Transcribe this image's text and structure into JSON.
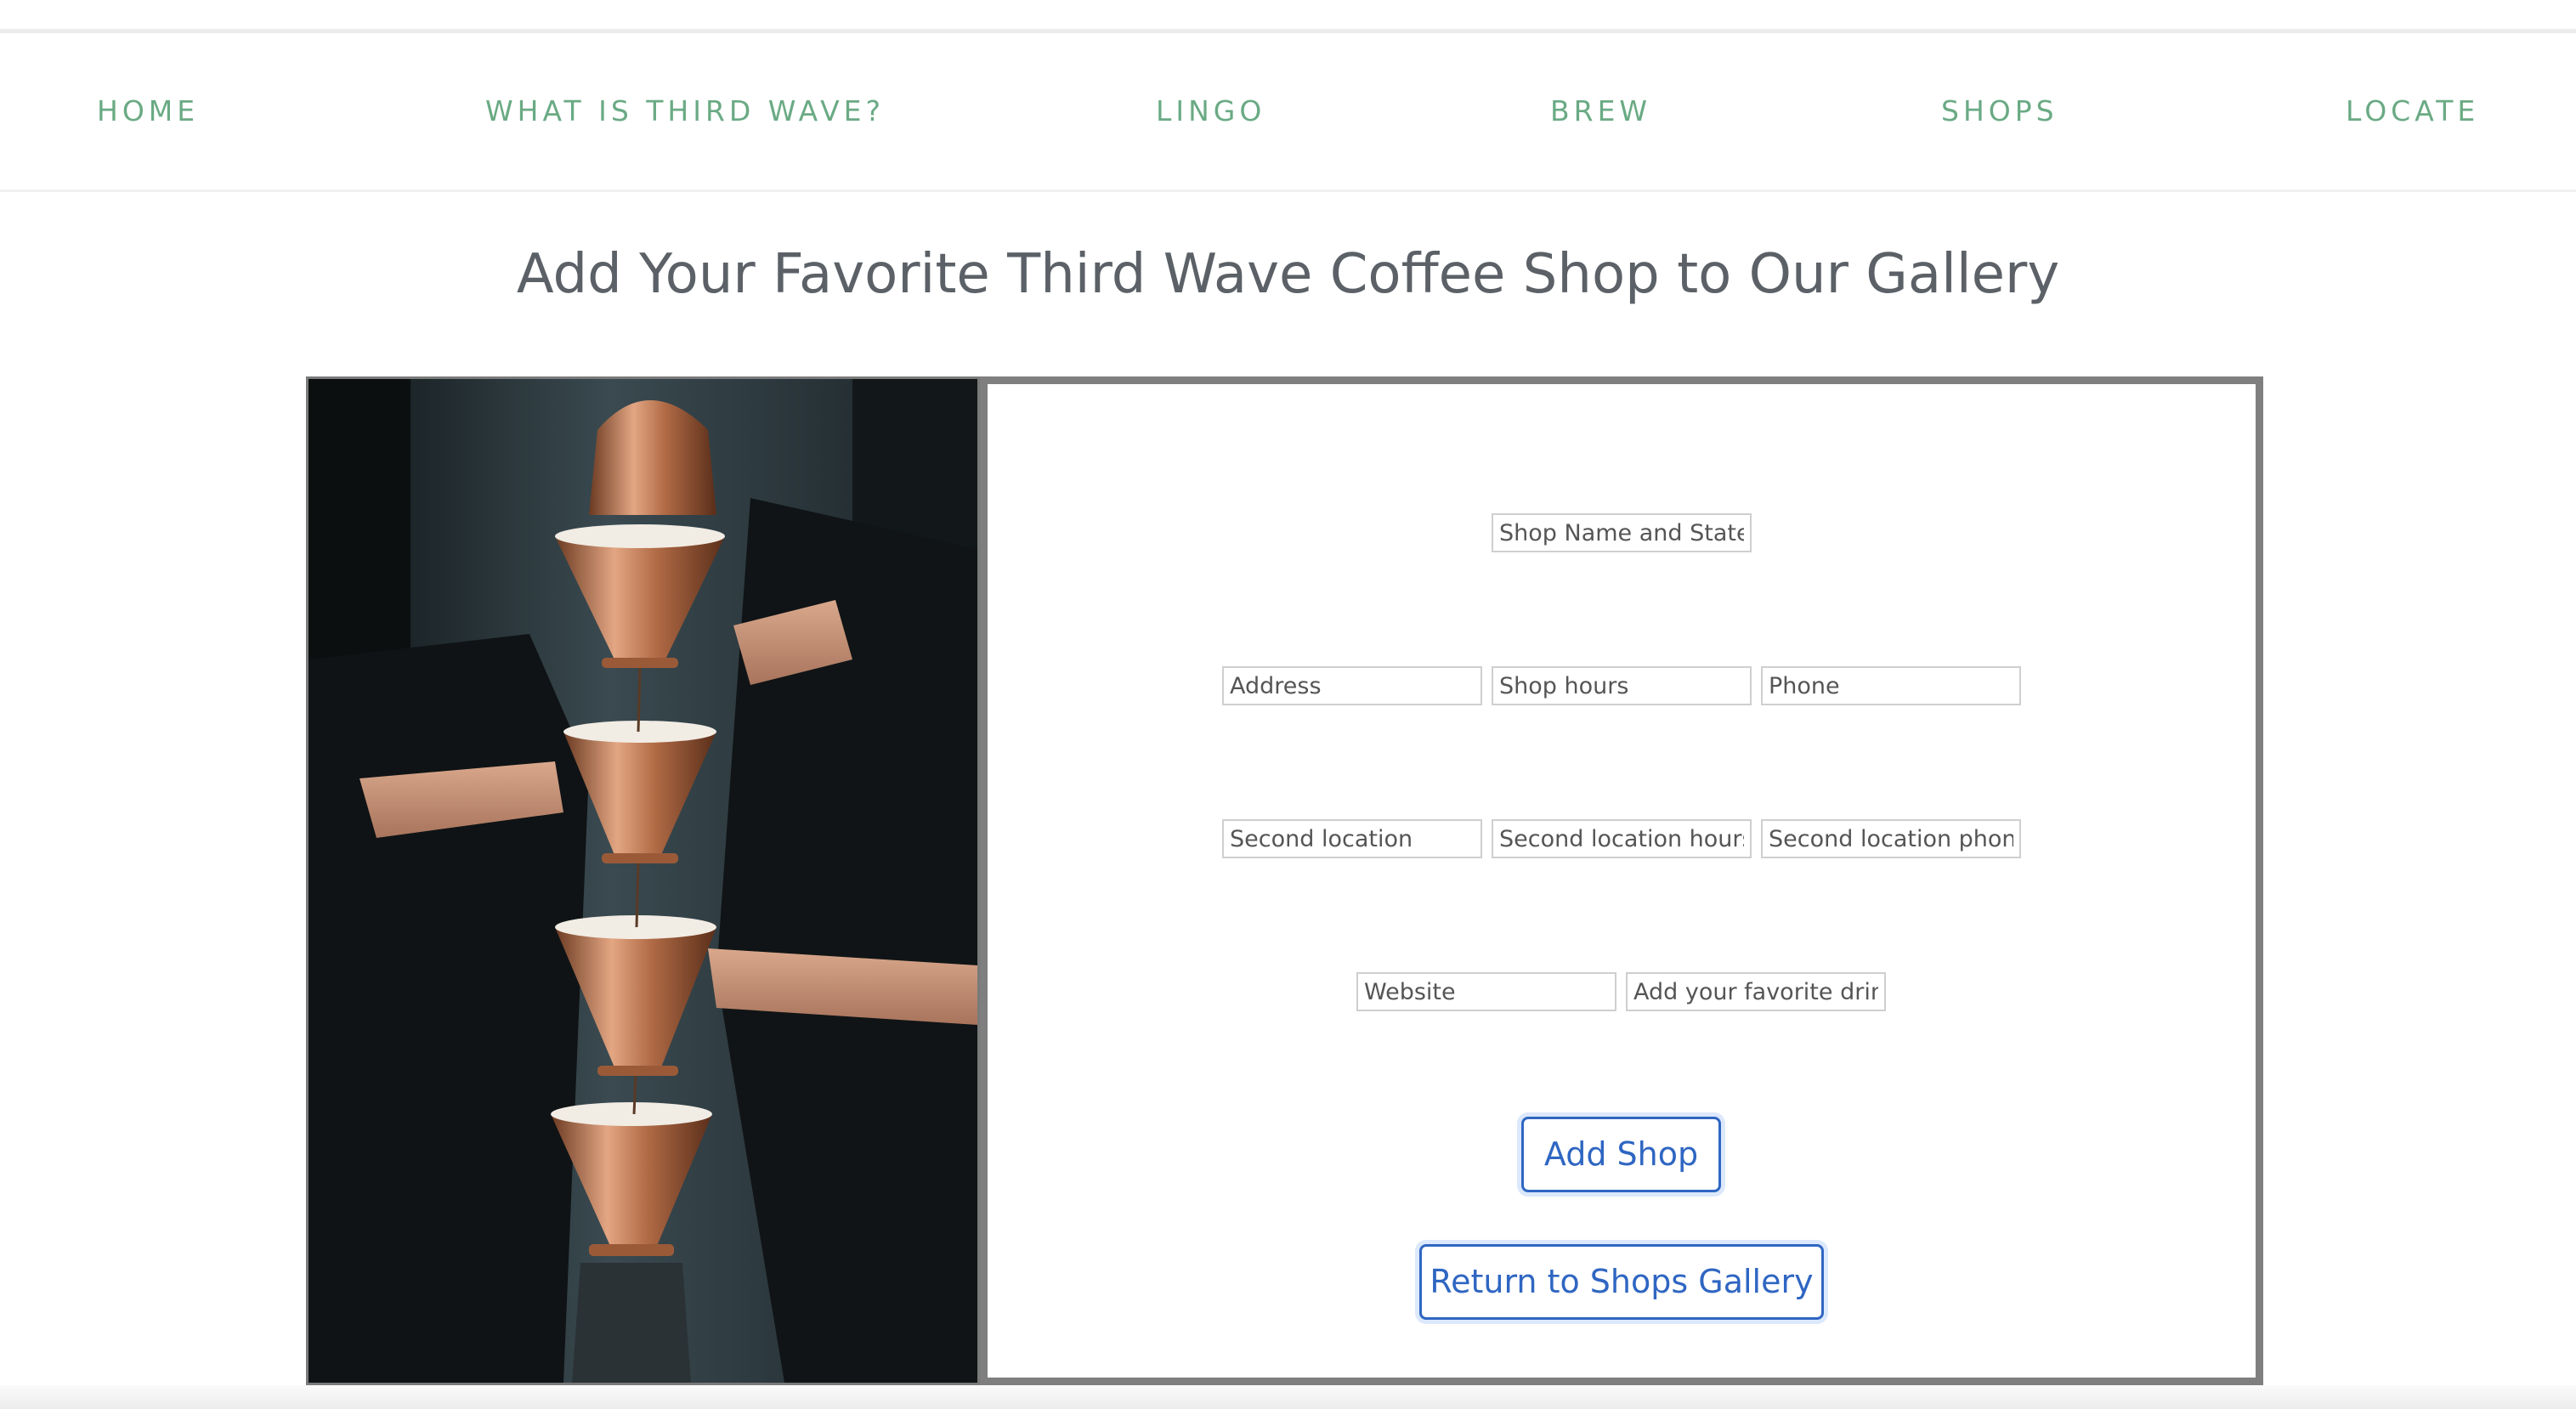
{
  "nav": {
    "items": [
      {
        "label": "HOME"
      },
      {
        "label": "WHAT IS THIRD WAVE?"
      },
      {
        "label": "LINGO"
      },
      {
        "label": "BREW"
      },
      {
        "label": "SHOPS"
      },
      {
        "label": "LOCATE"
      }
    ],
    "color": "#6aaa84"
  },
  "page": {
    "title": "Add Your Favorite Third Wave Coffee Shop to Our Gallery"
  },
  "photo": {
    "subject": "copper pour-over drippers stacked above a glass server"
  },
  "form": {
    "shop_name": {
      "placeholder": "Shop Name and State",
      "value": ""
    },
    "address": {
      "placeholder": "Address",
      "value": ""
    },
    "shop_hours": {
      "placeholder": "Shop hours",
      "value": ""
    },
    "phone": {
      "placeholder": "Phone",
      "value": ""
    },
    "second_location": {
      "placeholder": "Second location",
      "value": ""
    },
    "second_location_hours": {
      "placeholder": "Second location hours",
      "value": ""
    },
    "second_location_phone": {
      "placeholder": "Second location phone",
      "value": ""
    },
    "website": {
      "placeholder": "Website",
      "value": ""
    },
    "favorite_drink": {
      "placeholder": "Add your favorite drink",
      "value": ""
    },
    "add_button": "Add Shop",
    "return_button": "Return to Shops Gallery",
    "accent_color": "#2f66c2"
  }
}
